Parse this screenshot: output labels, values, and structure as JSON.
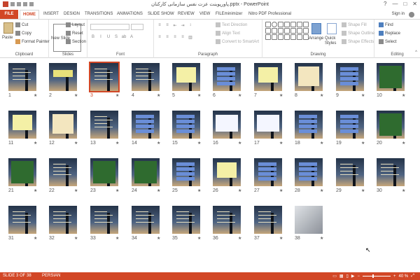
{
  "window": {
    "title": "پاورپوینت عزت نفس سازمانی کارکنان.pptx - PowerPoint",
    "sign_in": "Sign in",
    "controls": [
      "?",
      "—",
      "□",
      "✕"
    ]
  },
  "tabs": [
    {
      "label": "FILE"
    },
    {
      "label": "HOME"
    },
    {
      "label": "INSERT"
    },
    {
      "label": "DESIGN"
    },
    {
      "label": "TRANSITIONS"
    },
    {
      "label": "ANIMATIONS"
    },
    {
      "label": "SLIDE SHOW"
    },
    {
      "label": "REVIEW"
    },
    {
      "label": "VIEW"
    },
    {
      "label": "FILEminimizer"
    },
    {
      "label": "Nitro PDF Professional"
    }
  ],
  "ribbon": {
    "clipboard": {
      "label": "Clipboard",
      "paste": "Paste",
      "cut": "Cut",
      "copy": "Copy",
      "format_painter": "Format Painter"
    },
    "slides": {
      "label": "Slides",
      "new_slide": "New Slide",
      "layout": "Layout",
      "reset": "Reset",
      "section": "Section"
    },
    "font": {
      "label": "Font"
    },
    "paragraph": {
      "label": "Paragraph",
      "text_direction": "Text Direction",
      "align_text": "Align Text",
      "convert_smartart": "Convert to SmartArt"
    },
    "drawing": {
      "label": "Drawing",
      "arrange": "Arrange",
      "quick_styles": "Quick Styles",
      "shape_fill": "Shape Fill",
      "shape_outline": "Shape Outline",
      "shape_effects": "Shape Effects"
    },
    "editing": {
      "label": "Editing",
      "find": "Find",
      "replace": "Replace",
      "select": "Select"
    }
  },
  "slides": [
    {
      "num": "1",
      "selected": false
    },
    {
      "num": "2",
      "selected": false
    },
    {
      "num": "3",
      "selected": true
    },
    {
      "num": "4",
      "selected": false
    },
    {
      "num": "5",
      "selected": false
    },
    {
      "num": "6",
      "selected": false
    },
    {
      "num": "7",
      "selected": false
    },
    {
      "num": "8",
      "selected": false
    },
    {
      "num": "9",
      "selected": false
    },
    {
      "num": "10",
      "selected": false
    },
    {
      "num": "11",
      "selected": false
    },
    {
      "num": "12",
      "selected": false
    },
    {
      "num": "13",
      "selected": false
    },
    {
      "num": "14",
      "selected": false
    },
    {
      "num": "15",
      "selected": false
    },
    {
      "num": "16",
      "selected": false
    },
    {
      "num": "17",
      "selected": false
    },
    {
      "num": "18",
      "selected": false
    },
    {
      "num": "19",
      "selected": false
    },
    {
      "num": "20",
      "selected": false
    },
    {
      "num": "21",
      "selected": false
    },
    {
      "num": "22",
      "selected": false
    },
    {
      "num": "23",
      "selected": false
    },
    {
      "num": "24",
      "selected": false
    },
    {
      "num": "25",
      "selected": false
    },
    {
      "num": "26",
      "selected": false
    },
    {
      "num": "27",
      "selected": false
    },
    {
      "num": "28",
      "selected": false
    },
    {
      "num": "29",
      "selected": false
    },
    {
      "num": "30",
      "selected": false
    },
    {
      "num": "31",
      "selected": false
    },
    {
      "num": "32",
      "selected": false
    },
    {
      "num": "33",
      "selected": false
    },
    {
      "num": "34",
      "selected": false
    },
    {
      "num": "35",
      "selected": false
    },
    {
      "num": "36",
      "selected": false
    },
    {
      "num": "37",
      "selected": false
    },
    {
      "num": "38",
      "selected": false
    }
  ],
  "status": {
    "slide_info": "SLIDE 3 OF 38",
    "language": "PERSIAN",
    "zoom": "40 %"
  },
  "colors": {
    "accent": "#d24726"
  }
}
